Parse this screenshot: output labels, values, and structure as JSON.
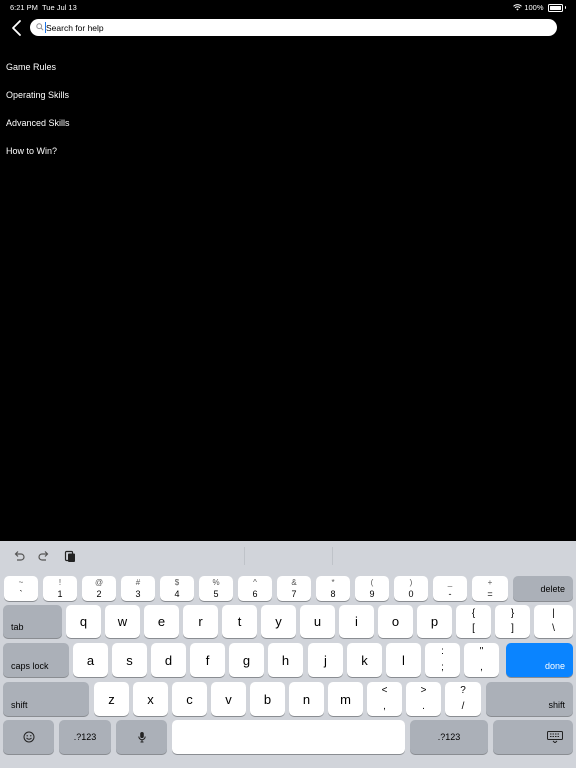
{
  "status_bar": {
    "time": "6:21 PM",
    "date": "Tue Jul 13",
    "battery": "100%"
  },
  "search": {
    "placeholder": "Search for help",
    "value": ""
  },
  "menu": {
    "items": [
      "Game Rules",
      "Operating Skills",
      "Advanced Skills",
      "How to Win?"
    ]
  },
  "keyboard": {
    "row1": [
      {
        "top": "~",
        "bot": "`"
      },
      {
        "top": "!",
        "bot": "1"
      },
      {
        "top": "@",
        "bot": "2"
      },
      {
        "top": "#",
        "bot": "3"
      },
      {
        "top": "$",
        "bot": "4"
      },
      {
        "top": "%",
        "bot": "5"
      },
      {
        "top": "^",
        "bot": "6"
      },
      {
        "top": "&",
        "bot": "7"
      },
      {
        "top": "*",
        "bot": "8"
      },
      {
        "top": "(",
        "bot": "9"
      },
      {
        "top": ")",
        "bot": "0"
      },
      {
        "top": "_",
        "bot": "-"
      },
      {
        "top": "+",
        "bot": "="
      }
    ],
    "delete": "delete",
    "tab": "tab",
    "row2": [
      "q",
      "w",
      "e",
      "r",
      "t",
      "y",
      "u",
      "i",
      "o",
      "p"
    ],
    "row2_sym": [
      {
        "top": "{",
        "bot": "["
      },
      {
        "top": "}",
        "bot": "]"
      },
      {
        "top": "|",
        "bot": "\\"
      }
    ],
    "caps": "caps lock",
    "row3": [
      "a",
      "s",
      "d",
      "f",
      "g",
      "h",
      "j",
      "k",
      "l"
    ],
    "row3_sym": [
      {
        "top": ":",
        "bot": ";"
      },
      {
        "top": "\"",
        "bot": ","
      }
    ],
    "done": "done",
    "shift": "shift",
    "row4": [
      "z",
      "x",
      "c",
      "v",
      "b",
      "n",
      "m"
    ],
    "row4_sym": [
      {
        "top": "<",
        "bot": ","
      },
      {
        "top": ">",
        "bot": "."
      },
      {
        "top": "?",
        "bot": "/"
      }
    ],
    "num_left": ".?123",
    "num_right": ".?123"
  }
}
